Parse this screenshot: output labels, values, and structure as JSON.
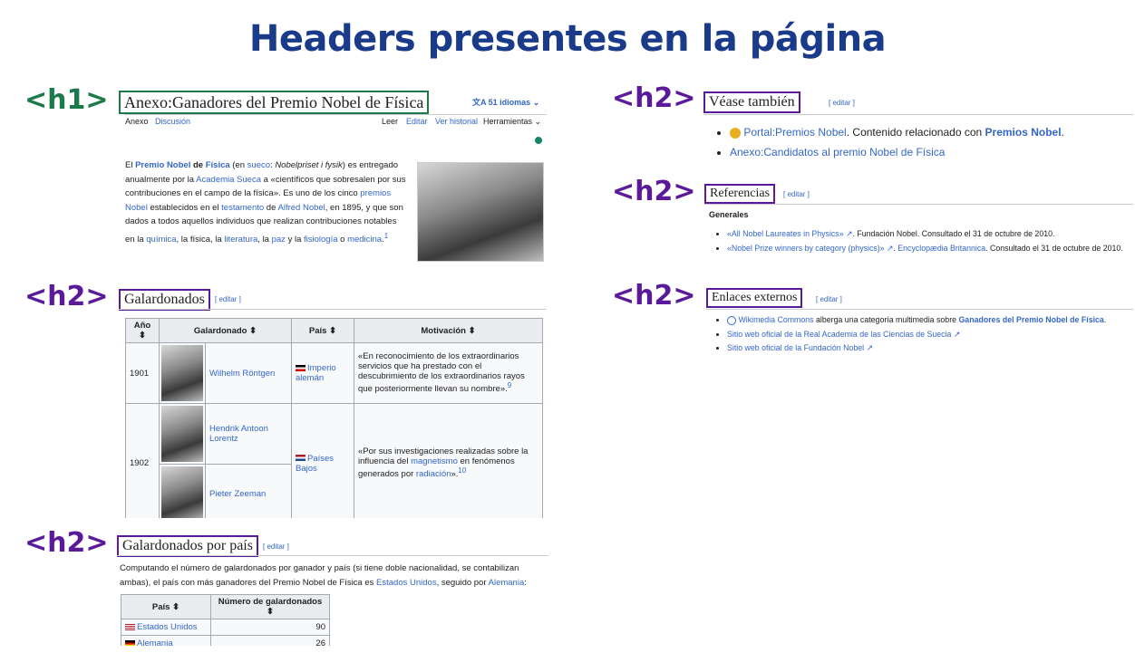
{
  "title": "Headers presentes en la página",
  "tags": {
    "h1": "<h1>",
    "h2": "<h2>"
  },
  "article": {
    "heading": "Anexo:Ganadores del Premio Nobel de Física",
    "languages": "51 idiomas",
    "tabs_left": [
      "Anexo",
      "Discusión"
    ],
    "tabs_right": [
      "Leer",
      "Editar",
      "Ver historial",
      "Herramientas"
    ],
    "intro": {
      "t1": "El ",
      "l1": "Premio Nobel",
      "t2": " de ",
      "l2": "Física",
      "t3": " (en ",
      "l3": "sueco",
      "t4": ": ",
      "t5": "Nobelpriset i fysik",
      "t6": ") es entregado anualmente por la ",
      "l4": "Academia Sueca",
      "t7": " a «científicos que sobresalen por sus contribuciones en el campo de la física». Es uno de los cinco ",
      "l5": "premios Nobel",
      "t8": " establecidos en el ",
      "l6": "testamento",
      "t9": " de ",
      "l7": "Alfred Nobel",
      "t10": ", en 1895, y que son dados a todos aquellos individuos que realizan contribuciones notables en la ",
      "l8": "química",
      "t11": ", la física, la ",
      "l9": "literatura",
      "t12": ", la ",
      "l10": "paz",
      "t13": " y la ",
      "l11": "fisiología",
      "t14": " o ",
      "l12": "medicina",
      "t15": ".",
      "sup": "1"
    }
  },
  "galardonados": {
    "heading": "Galardonados",
    "editar": "[ editar ]",
    "headers": [
      "Año",
      "Galardonado",
      "País",
      "Motivación"
    ],
    "rows": [
      {
        "year": "1901",
        "name": "Wilhelm Röntgen",
        "country": "Imperio alemán",
        "motivation": "«En reconocimiento de los extraordinarios servicios que ha prestado con el descubrimiento de los extraordinarios rayos que posteriormente llevan su nombre».",
        "sup": "9"
      },
      {
        "year": "1902",
        "name": "Hendrik Antoon Lorentz",
        "name2": "Pieter Zeeman",
        "country": "Países Bajos",
        "m1": "«Por sus investigaciones realizadas sobre la influencia del ",
        "m_l1": "magnetismo",
        "m2": " en fenómenos generados por ",
        "m_l2": "radiación",
        "m3": "».",
        "sup": "10"
      }
    ]
  },
  "por_pais": {
    "heading": "Galardonados por país",
    "editar": "[ editar ]",
    "p1": "Computando el número de galardonados por ganador y país (si tiene doble nacionalidad, se contabilizan ambas), el país con más ganadores del Premio Nobel de Física es ",
    "l1": "Estados Unidos",
    "p2": ", seguido por ",
    "l2": "Alemania",
    "p3": ":",
    "headers": [
      "País",
      "Número de galardonados"
    ],
    "rows": [
      {
        "country": "Estados Unidos",
        "count": "90"
      },
      {
        "country": "Alemania",
        "count": "26"
      }
    ]
  },
  "vease": {
    "heading": "Véase también",
    "editar": "[ editar ]",
    "item1_link": "Portal:Premios Nobel",
    "item1_text": ". Contenido relacionado con ",
    "item1_bold": "Premios Nobel",
    "item1_end": ".",
    "item2": "Anexo:Candidatos al premio Nobel de Física"
  },
  "referencias": {
    "heading": "Referencias",
    "editar": "[ editar ]",
    "sub": "Generales",
    "r1_link": "«All Nobel Laureates in Physics»",
    "r1_text": ". Fundación Nobel. Consultado el 31 de octubre de 2010.",
    "r2_link": "«Nobel Prize winners by category (physics)»",
    "r2_mid": ". ",
    "r2_link2": "Encyclopædia Britannica",
    "r2_text": ". Consultado el 31 de octubre de 2010."
  },
  "enlaces": {
    "heading": "Enlaces externos",
    "editar": "[ editar ]",
    "e1_link": "Wikimedia Commons",
    "e1_text": " alberga una categoría multimedia sobre ",
    "e1_bold": "Ganadores del Premio Nobel de Física",
    "e1_end": ".",
    "e2": "Sitio web oficial de la Real Academia de las Ciencias de Suecia",
    "e3": "Sitio web oficial de la Fundación Nobel"
  },
  "colors": {
    "title": "#1a3a8a",
    "h1": "#1a7a4a",
    "h2": "#5a1a9a",
    "link": "#3366cc"
  }
}
